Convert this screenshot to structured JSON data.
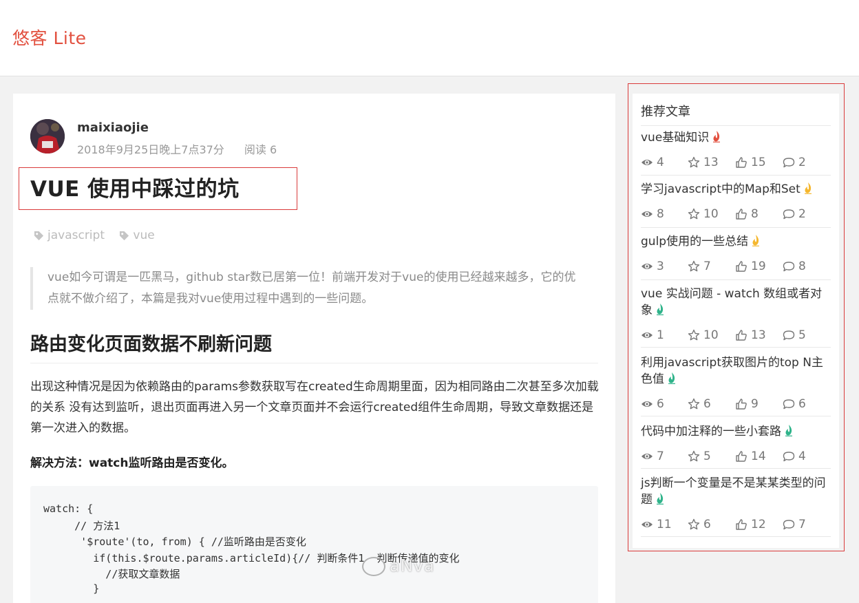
{
  "header": {
    "brand": "悠客 Lite"
  },
  "article": {
    "author": "maixiaojie",
    "date": "2018年9月25日晚上7点37分",
    "read": "阅读 6",
    "title": "VUE 使用中踩过的坑",
    "tags": [
      "javascript",
      "vue"
    ],
    "summary": "vue如今可谓是一匹黑马，github star数已居第一位！前端开发对于vue的使用已经越来越多，它的优点就不做介绍了，本篇是我对vue使用过程中遇到的一些问题。",
    "section_title": "路由变化页面数据不刷新问题",
    "paragraph": "出现这种情况是因为依赖路由的params参数获取写在created生命周期里面，因为相同路由二次甚至多次加载的关系 没有达到监听，退出页面再进入另一个文章页面并不会运行created组件生命周期，导致文章数据还是第一次进入的数据。",
    "solution": "解决方法：watch监听路由是否变化。",
    "code": [
      "watch: {",
      "     // 方法1",
      "      '$route'(to, from) { //监听路由是否变化",
      "        if(this.$route.params.articleId){// 判断条件1  判断传递值的变化",
      "          //获取文章数据",
      "        }"
    ]
  },
  "watermark": "aNva",
  "sidebar": {
    "title": "推荐文章",
    "items": [
      {
        "title": "vue基础知识",
        "flame": "#e2503f",
        "views": "4",
        "stars": "13",
        "likes": "15",
        "comments": "2"
      },
      {
        "title": "学习javascript中的Map和Set",
        "flame": "#f5b72e",
        "views": "8",
        "stars": "10",
        "likes": "8",
        "comments": "2"
      },
      {
        "title": "gulp使用的一些总结",
        "flame": "#f5b72e",
        "views": "3",
        "stars": "7",
        "likes": "19",
        "comments": "8"
      },
      {
        "title": "vue 实战问题 - watch 数组或者对象",
        "flame": "#2fb38a",
        "views": "1",
        "stars": "10",
        "likes": "13",
        "comments": "5"
      },
      {
        "title": "利用javascript获取图片的top N主色值",
        "flame": "#2fb38a",
        "views": "6",
        "stars": "6",
        "likes": "9",
        "comments": "6"
      },
      {
        "title": "代码中加注释的一些小套路",
        "flame": "#2fb38a",
        "views": "7",
        "stars": "5",
        "likes": "14",
        "comments": "4"
      },
      {
        "title": "js判断一个变量是不是某某类型的问题",
        "flame": "#2fb38a",
        "views": "11",
        "stars": "6",
        "likes": "12",
        "comments": "7"
      }
    ]
  }
}
